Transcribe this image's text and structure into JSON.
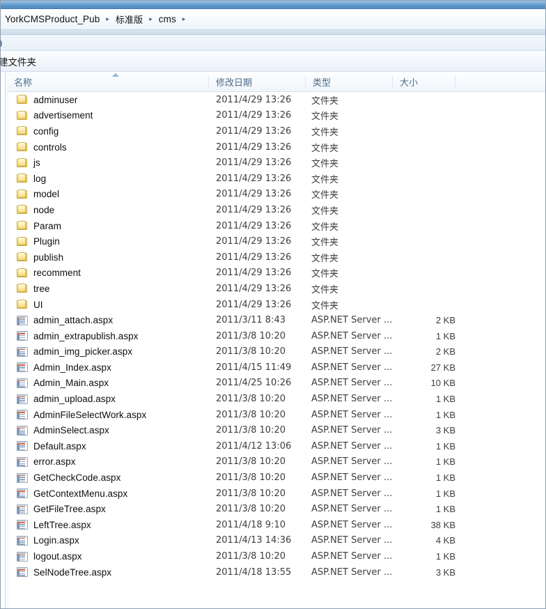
{
  "window": {
    "title_strip_color": "#5b96c9"
  },
  "address_bar": {
    "crumbs": [
      "YorkCMSProduct_Pub",
      "标准版",
      "cms"
    ],
    "separator": "▸"
  },
  "search_row": {
    "clipped_text": ")"
  },
  "toolbar": {
    "new_folder_label": "建文件夹"
  },
  "list": {
    "columns": [
      {
        "label": "名称",
        "key": "name"
      },
      {
        "label": "修改日期",
        "key": "date"
      },
      {
        "label": "类型",
        "key": "type"
      },
      {
        "label": "大小",
        "key": "size"
      }
    ],
    "sort_column": "名称",
    "sort_direction": "ascending",
    "rows": [
      {
        "icon": "folder-icon",
        "name": "adminuser",
        "date": "2011/4/29 13:26",
        "type": "文件夹",
        "size": ""
      },
      {
        "icon": "folder-icon",
        "name": "advertisement",
        "date": "2011/4/29 13:26",
        "type": "文件夹",
        "size": ""
      },
      {
        "icon": "folder-icon",
        "name": "config",
        "date": "2011/4/29 13:26",
        "type": "文件夹",
        "size": ""
      },
      {
        "icon": "folder-icon",
        "name": "controls",
        "date": "2011/4/29 13:26",
        "type": "文件夹",
        "size": ""
      },
      {
        "icon": "folder-icon",
        "name": "js",
        "date": "2011/4/29 13:26",
        "type": "文件夹",
        "size": ""
      },
      {
        "icon": "folder-icon",
        "name": "log",
        "date": "2011/4/29 13:26",
        "type": "文件夹",
        "size": ""
      },
      {
        "icon": "folder-icon",
        "name": "model",
        "date": "2011/4/29 13:26",
        "type": "文件夹",
        "size": ""
      },
      {
        "icon": "folder-icon",
        "name": "node",
        "date": "2011/4/29 13:26",
        "type": "文件夹",
        "size": ""
      },
      {
        "icon": "folder-icon",
        "name": "Param",
        "date": "2011/4/29 13:26",
        "type": "文件夹",
        "size": ""
      },
      {
        "icon": "folder-icon",
        "name": "Plugin",
        "date": "2011/4/29 13:26",
        "type": "文件夹",
        "size": ""
      },
      {
        "icon": "folder-icon",
        "name": "publish",
        "date": "2011/4/29 13:26",
        "type": "文件夹",
        "size": ""
      },
      {
        "icon": "folder-icon",
        "name": "recomment",
        "date": "2011/4/29 13:26",
        "type": "文件夹",
        "size": ""
      },
      {
        "icon": "folder-icon",
        "name": "tree",
        "date": "2011/4/29 13:26",
        "type": "文件夹",
        "size": ""
      },
      {
        "icon": "folder-icon",
        "name": "UI",
        "date": "2011/4/29 13:26",
        "type": "文件夹",
        "size": ""
      },
      {
        "icon": "aspx-file-icon",
        "name": "admin_attach.aspx",
        "date": "2011/3/11 8:43",
        "type": "ASP.NET Server ...",
        "size": "2 KB"
      },
      {
        "icon": "aspx-file-icon",
        "name": "admin_extrapublish.aspx",
        "date": "2011/3/8 10:20",
        "type": "ASP.NET Server ...",
        "size": "1 KB"
      },
      {
        "icon": "aspx-file-icon",
        "name": "admin_img_picker.aspx",
        "date": "2011/3/8 10:20",
        "type": "ASP.NET Server ...",
        "size": "2 KB"
      },
      {
        "icon": "aspx-file-icon",
        "name": "Admin_Index.aspx",
        "date": "2011/4/15 11:49",
        "type": "ASP.NET Server ...",
        "size": "27 KB"
      },
      {
        "icon": "aspx-file-icon",
        "name": "Admin_Main.aspx",
        "date": "2011/4/25 10:26",
        "type": "ASP.NET Server ...",
        "size": "10 KB"
      },
      {
        "icon": "aspx-file-icon",
        "name": "admin_upload.aspx",
        "date": "2011/3/8 10:20",
        "type": "ASP.NET Server ...",
        "size": "1 KB"
      },
      {
        "icon": "aspx-file-icon",
        "name": "AdminFileSelectWork.aspx",
        "date": "2011/3/8 10:20",
        "type": "ASP.NET Server ...",
        "size": "1 KB"
      },
      {
        "icon": "aspx-file-icon",
        "name": "AdminSelect.aspx",
        "date": "2011/3/8 10:20",
        "type": "ASP.NET Server ...",
        "size": "3 KB"
      },
      {
        "icon": "aspx-file-icon",
        "name": "Default.aspx",
        "date": "2011/4/12 13:06",
        "type": "ASP.NET Server ...",
        "size": "1 KB"
      },
      {
        "icon": "aspx-file-icon",
        "name": "error.aspx",
        "date": "2011/3/8 10:20",
        "type": "ASP.NET Server ...",
        "size": "1 KB"
      },
      {
        "icon": "aspx-file-icon",
        "name": "GetCheckCode.aspx",
        "date": "2011/3/8 10:20",
        "type": "ASP.NET Server ...",
        "size": "1 KB"
      },
      {
        "icon": "aspx-file-icon",
        "name": "GetContextMenu.aspx",
        "date": "2011/3/8 10:20",
        "type": "ASP.NET Server ...",
        "size": "1 KB"
      },
      {
        "icon": "aspx-file-icon",
        "name": "GetFileTree.aspx",
        "date": "2011/3/8 10:20",
        "type": "ASP.NET Server ...",
        "size": "1 KB"
      },
      {
        "icon": "aspx-file-icon",
        "name": "LeftTree.aspx",
        "date": "2011/4/18 9:10",
        "type": "ASP.NET Server ...",
        "size": "38 KB"
      },
      {
        "icon": "aspx-file-icon",
        "name": "Login.aspx",
        "date": "2011/4/13 14:36",
        "type": "ASP.NET Server ...",
        "size": "4 KB"
      },
      {
        "icon": "aspx-file-icon",
        "name": "logout.aspx",
        "date": "2011/3/8 10:20",
        "type": "ASP.NET Server ...",
        "size": "1 KB"
      },
      {
        "icon": "aspx-file-icon",
        "name": "SelNodeTree.aspx",
        "date": "2011/4/18 13:55",
        "type": "ASP.NET Server ...",
        "size": "3 KB"
      }
    ]
  }
}
